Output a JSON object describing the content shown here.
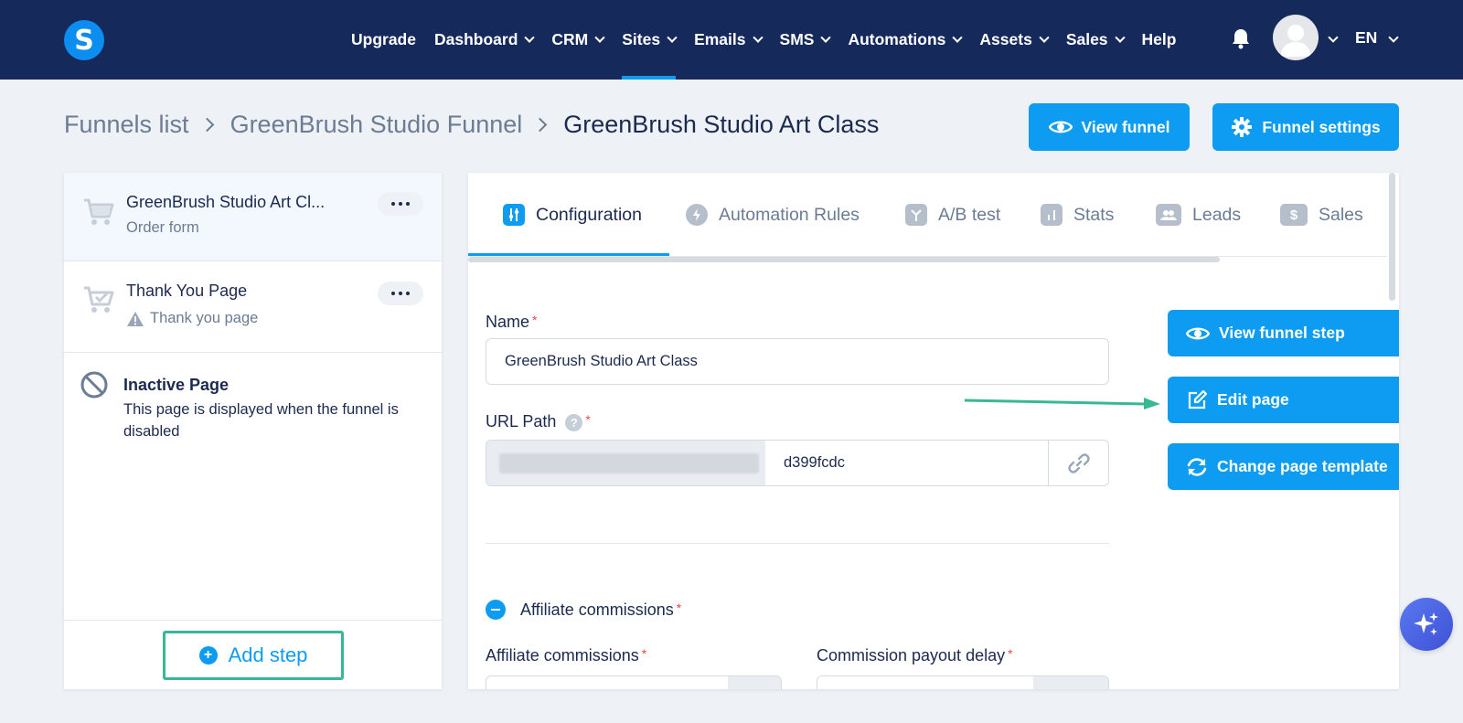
{
  "topnav": {
    "logo_letter": "S",
    "items": [
      {
        "label": "Upgrade",
        "dropdown": false
      },
      {
        "label": "Dashboard",
        "dropdown": true
      },
      {
        "label": "CRM",
        "dropdown": true
      },
      {
        "label": "Sites",
        "dropdown": true,
        "active": true
      },
      {
        "label": "Emails",
        "dropdown": true
      },
      {
        "label": "SMS",
        "dropdown": true
      },
      {
        "label": "Automations",
        "dropdown": true
      },
      {
        "label": "Assets",
        "dropdown": true
      },
      {
        "label": "Sales",
        "dropdown": true
      },
      {
        "label": "Help",
        "dropdown": false
      }
    ],
    "language": "EN"
  },
  "breadcrumb": {
    "items": [
      "Funnels list",
      "GreenBrush Studio Funnel"
    ],
    "current": "GreenBrush Studio Art Class"
  },
  "header_actions": {
    "view_funnel": "View funnel",
    "funnel_settings": "Funnel settings"
  },
  "steps": [
    {
      "title": "GreenBrush Studio Art Cl...",
      "subtitle": "Order form"
    },
    {
      "title": "Thank You Page",
      "subtitle": "Thank you page"
    },
    {
      "title": "Inactive Page",
      "subtitle": "This page is displayed when the funnel is disabled"
    }
  ],
  "add_step_label": "Add step",
  "tabs": [
    {
      "label": "Configuration",
      "active": true
    },
    {
      "label": "Automation Rules"
    },
    {
      "label": "A/B test"
    },
    {
      "label": "Stats"
    },
    {
      "label": "Leads"
    },
    {
      "label": "Sales"
    }
  ],
  "form": {
    "name_label": "Name",
    "name_value": "GreenBrush Studio Art Class",
    "url_label": "URL Path",
    "url_value": "d399fcdc",
    "affiliate_section": "Affiliate commissions",
    "affiliate_label": "Affiliate commissions",
    "payout_label": "Commission payout delay",
    "required_mark": "*"
  },
  "side_actions": {
    "view_step": "View funnel step",
    "edit_page": "Edit page",
    "change_template": "Change page template"
  },
  "colors": {
    "nav_bg": "#15295a",
    "primary": "#0d9cf2",
    "highlight": "#3ab795"
  }
}
